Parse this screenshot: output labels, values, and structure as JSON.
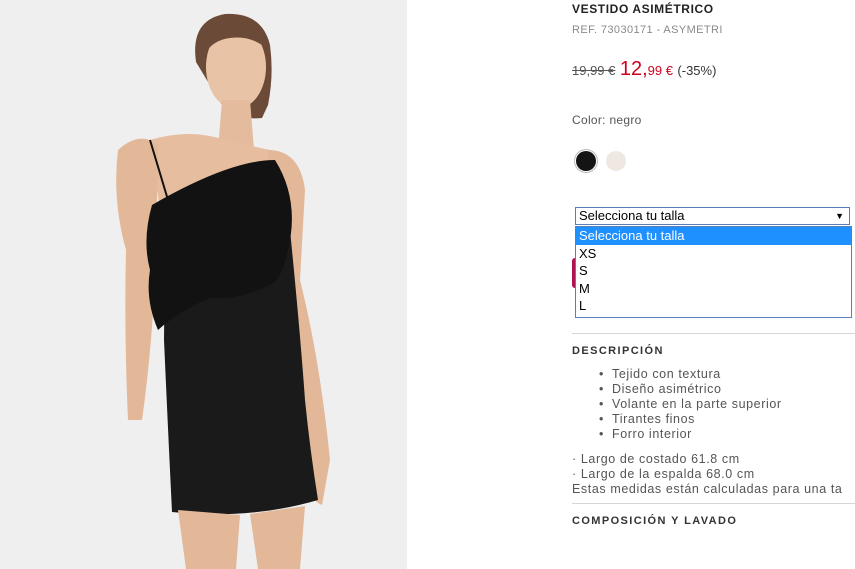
{
  "product": {
    "title": "VESTIDO ASIMÉTRICO",
    "ref": "REF. 73030171 - ASYMETRI",
    "old_price": "19,99 €",
    "new_price_int": "12,",
    "new_price_dec": "99 €",
    "discount": "(-35%)",
    "color_label": "Color: negro",
    "swatches": [
      {
        "name": "negro",
        "hex": "#141414"
      },
      {
        "name": "crudo",
        "hex": "#efe8e1"
      }
    ]
  },
  "size_select": {
    "selected": "Selecciona tu talla",
    "options": [
      "Selecciona tu talla",
      "XS",
      "S",
      "M",
      "L"
    ]
  },
  "description": {
    "heading": "DESCRIPCIÓN",
    "features": [
      "Tejido con textura",
      "Diseño asimétrico",
      "Volante en la parte superior",
      "Tirantes finos",
      "Forro interior"
    ],
    "measures": [
      "· Largo de costado 61.8 cm",
      "· Largo de la espalda 68.0 cm",
      "Estas medidas están calculadas para una ta"
    ]
  },
  "composition": {
    "heading": "COMPOSICIÓN Y LAVADO"
  },
  "colors": {
    "price_red": "#d0021b",
    "select_blue": "#1e90ff",
    "cart_magenta": "#b0114f"
  }
}
